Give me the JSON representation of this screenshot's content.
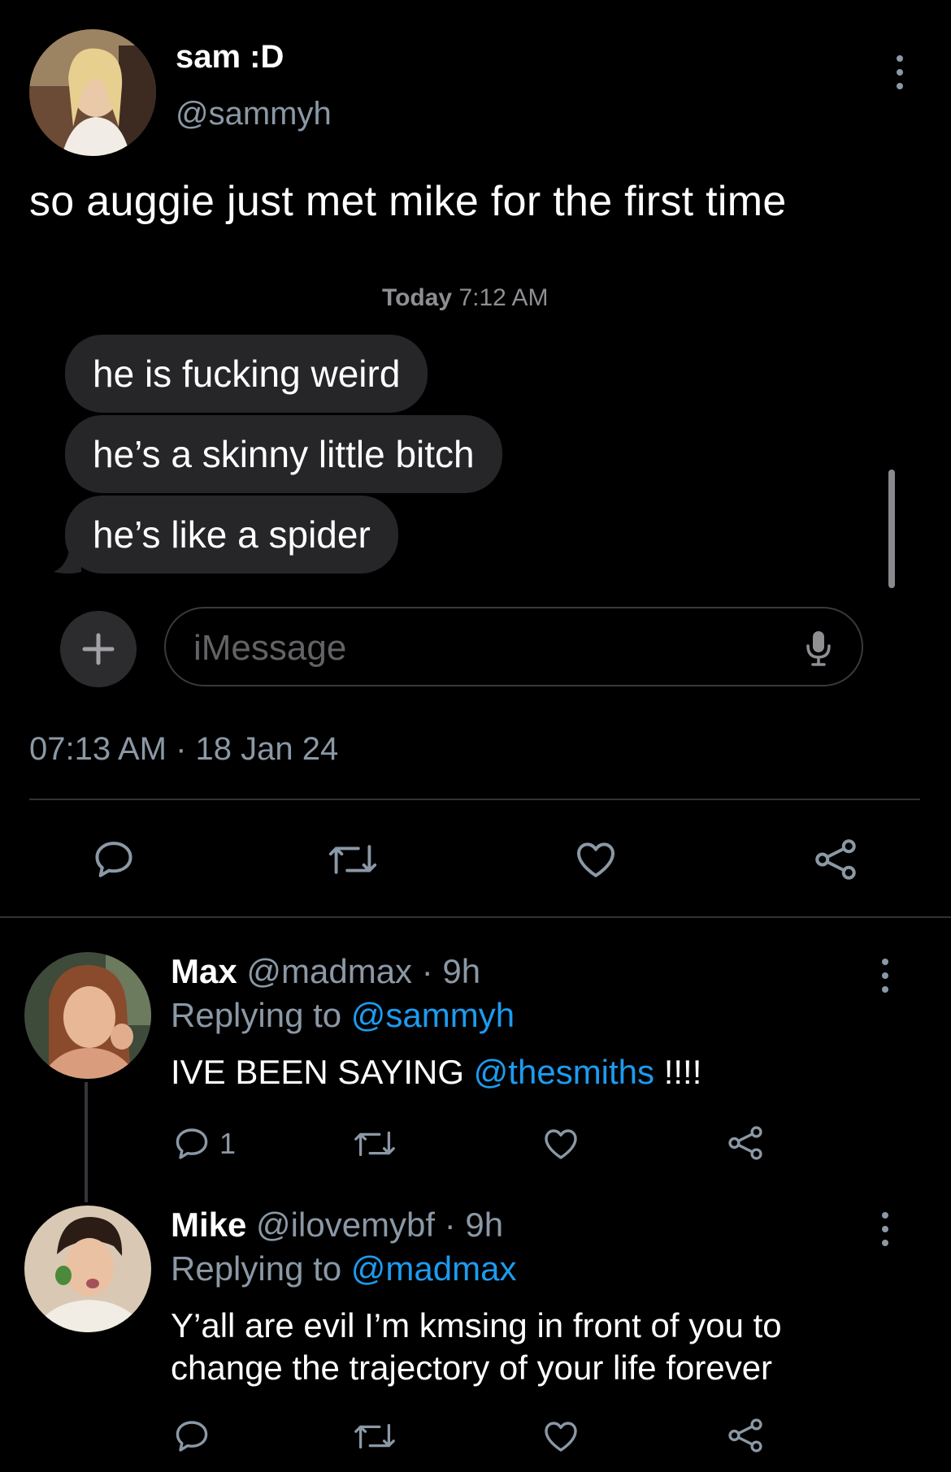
{
  "tweet": {
    "display_name": "sam :D",
    "handle": "@sammyh",
    "text": "so auggie just met mike for the first time",
    "meta": "07:13 AM · 18 Jan 24",
    "screenshot": {
      "timestamp_day": "Today",
      "timestamp_time": "7:12 AM",
      "messages": [
        "he is fucking weird",
        "he’s a skinny little bitch",
        "he’s like a spider"
      ],
      "input_placeholder": "iMessage"
    }
  },
  "replies": [
    {
      "display_name": "Max",
      "handle": "@madmax",
      "time": "· 9h",
      "replying_label": "Replying to",
      "replying_to": "@sammyh",
      "text_before": "IVE BEEN SAYING ",
      "mention": "@thesmiths",
      "text_after": " !!!!",
      "reply_count": "1"
    },
    {
      "display_name": "Mike",
      "handle": "@ilovemybf",
      "time": "· 9h",
      "replying_label": "Replying to",
      "replying_to": "@madmax",
      "text": "Y’all are evil I’m kmsing in front of you to change the trajectory of your life forever"
    }
  ],
  "colors": {
    "background": "#000000",
    "muted": "#8b98a5",
    "link": "#1d9bf0",
    "bubble": "#262629"
  }
}
